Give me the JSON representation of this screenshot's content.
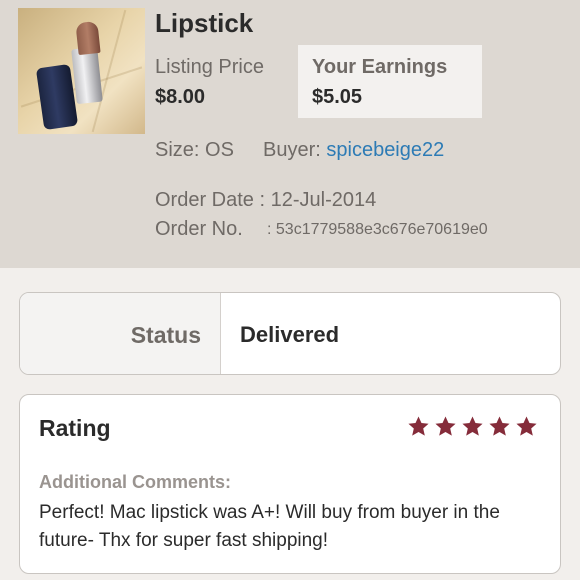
{
  "item": {
    "title": "Lipstick",
    "listing_price_label": "Listing Price",
    "listing_price_value": "$8.00",
    "earnings_label": "Your Earnings",
    "earnings_value": "$5.05",
    "size_label": "Size:",
    "size_value": "OS",
    "buyer_label": "Buyer:",
    "buyer_value": "spicebeige22",
    "order_date_label": "Order Date :",
    "order_date_value": "12-Jul-2014",
    "order_no_label": "Order No.",
    "order_no_value": ": 53c1779588e3c676e70619e0"
  },
  "status": {
    "label": "Status",
    "value": "Delivered"
  },
  "rating": {
    "title": "Rating",
    "stars": 5,
    "star_color": "#852c3a",
    "comments_label": "Additional Comments:",
    "comments_text": "Perfect! Mac lipstick was A+! Will buy from buyer in the future- Thx for super fast shipping!"
  },
  "colors": {
    "summary_background": "#ddd8d2",
    "buyer_link": "#2d7bb5"
  }
}
